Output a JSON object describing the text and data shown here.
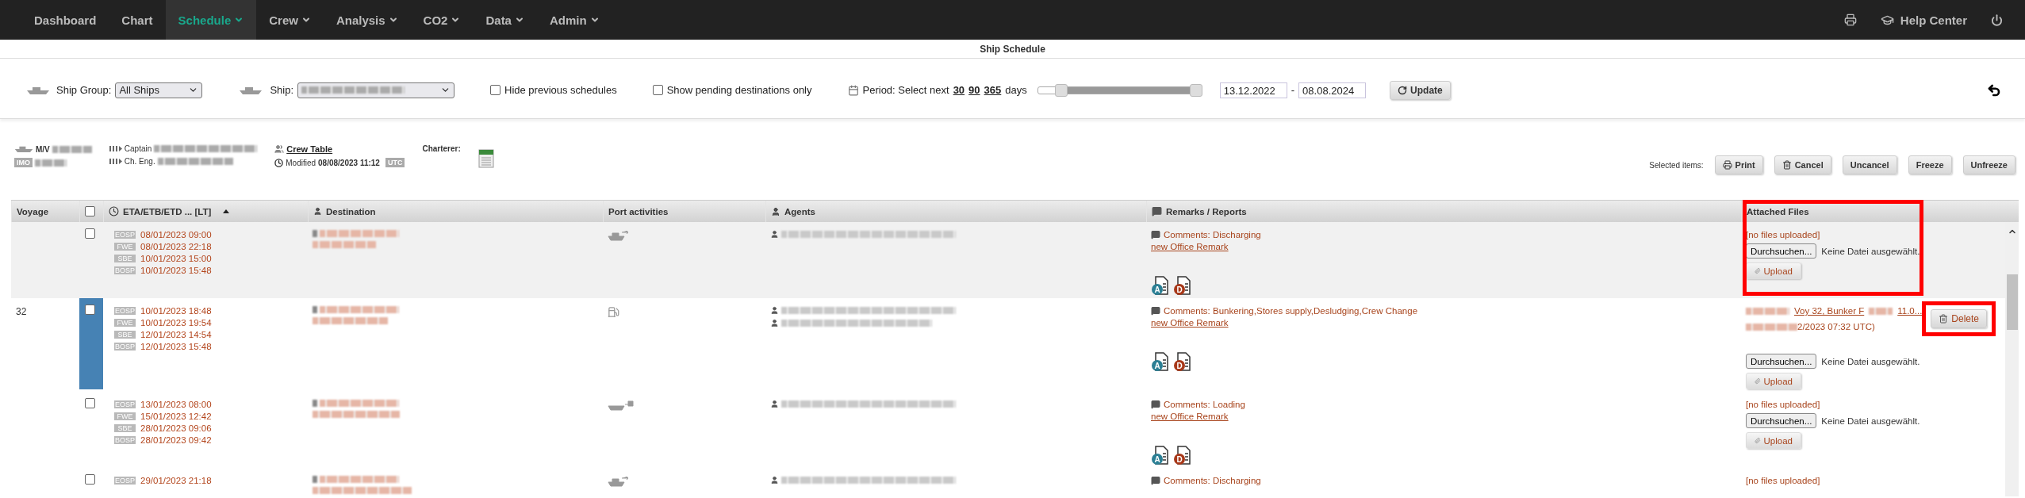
{
  "nav": {
    "items": [
      {
        "label": "Dashboard",
        "selected": false,
        "dropdown": false
      },
      {
        "label": "Chart",
        "selected": false,
        "dropdown": false
      },
      {
        "label": "Schedule",
        "selected": true,
        "dropdown": true
      },
      {
        "label": "Crew",
        "selected": false,
        "dropdown": true
      },
      {
        "label": "Analysis",
        "selected": false,
        "dropdown": true
      },
      {
        "label": "CO2",
        "selected": false,
        "dropdown": true
      },
      {
        "label": "Data",
        "selected": false,
        "dropdown": true
      },
      {
        "label": "Admin",
        "selected": false,
        "dropdown": true
      }
    ],
    "help": "Help Center"
  },
  "page_title": "Ship Schedule",
  "filters": {
    "ship_group_label": "Ship Group:",
    "ship_group_value": "All Ships",
    "ship_label": "Ship:",
    "checkboxes": [
      {
        "label": "Hide previous schedules",
        "checked": false
      },
      {
        "label": "Show pending destinations only",
        "checked": false
      }
    ],
    "period_label": "Period: Select next",
    "period_options": [
      "30",
      "90",
      "365"
    ],
    "period_unit": "days",
    "slider": {
      "thumbs": [
        {
          "level": 0.15
        },
        {
          "level": 1
        }
      ]
    },
    "date_from": "13.12.2022",
    "date_separator": "-",
    "date_to": "08.08.2024",
    "update": "Update"
  },
  "vessel": {
    "prefix": "M/V",
    "imo_badge": "IMO",
    "captain_label": "Captain",
    "chief_label": "Ch. Eng.",
    "crew_table": "Crew Table",
    "modified_label": "Modified",
    "modified": "08/08/2023 11:12",
    "utc_badge": "UTC",
    "charterer_label": "Charterer:"
  },
  "actions": {
    "label": "Selected items:",
    "buttons": [
      {
        "label": "Print"
      },
      {
        "label": "Cancel"
      },
      {
        "label": "Uncancel"
      },
      {
        "label": "Freeze"
      },
      {
        "label": "Unfreeze"
      }
    ]
  },
  "table": {
    "columns": [
      {
        "kind": "text",
        "label": "Voyage"
      },
      {
        "kind": "checkbox",
        "checked": false
      },
      {
        "kind": "text",
        "label": "ETA/ETB/ETD ... [LT]",
        "sorted": true
      },
      {
        "kind": "text",
        "label": "Destination"
      },
      {
        "kind": "text",
        "label": "Port activities"
      },
      {
        "kind": "text",
        "label": "Agents"
      },
      {
        "kind": "text",
        "label": "Remarks / Reports"
      },
      {
        "kind": "text",
        "label": "Attached Files",
        "highlighted": true
      }
    ],
    "rows": [
      {
        "shaded": true,
        "marker": false,
        "checked": false,
        "times": [
          {
            "label": "EOSP",
            "time": "08/01/2023 09:00"
          },
          {
            "label": "FWE",
            "time": "08/01/2023 22:18"
          },
          {
            "label": "SBE",
            "time": "10/01/2023 15:00"
          },
          {
            "label": "BOSP",
            "time": "10/01/2023 15:48"
          }
        ],
        "activity": {
          "kind": "discharging"
        },
        "agents": [
          {
            "kind": "blurred"
          }
        ],
        "comment": "Comments: Discharging",
        "office_remark": "new Office Remark",
        "reports": [
          "A",
          "D"
        ],
        "files": {
          "kind": "empty",
          "status": "[no files uploaded]",
          "browse": "Durchsuchen...",
          "no_file": "Keine Datei ausgewählt.",
          "upload": "Upload"
        }
      },
      {
        "voyage": "32",
        "shaded": false,
        "marker": true,
        "checked": false,
        "times": [
          {
            "label": "EOSP",
            "time": "10/01/2023 18:48"
          },
          {
            "label": "FWE",
            "time": "10/01/2023 19:54"
          },
          {
            "label": "SBE",
            "time": "12/01/2023 14:54"
          },
          {
            "label": "BOSP",
            "time": "12/01/2023 15:48"
          }
        ],
        "activity": {
          "kind": "bunkering"
        },
        "agents": [
          {
            "kind": "blurred"
          },
          {
            "kind": "blurred"
          }
        ],
        "comment": "Comments: Bunkering,Stores supply,Desludging,Crew Change",
        "office_remark": "new Office Remark",
        "reports": [
          "A",
          "D"
        ],
        "files": {
          "kind": "file",
          "link_parts": [
            "Voy 32, Bunker F",
            "11.0..."
          ],
          "uploaded": "2/2023 07:32 UTC)",
          "delete": "Delete",
          "delete_highlighted": true,
          "browse": "Durchsuchen...",
          "no_file": "Keine Datei ausgewählt.",
          "upload": "Upload"
        }
      },
      {
        "shaded": false,
        "marker": false,
        "checked": false,
        "times": [
          {
            "label": "EOSP",
            "time": "13/01/2023 08:00"
          },
          {
            "label": "FWE",
            "time": "15/01/2023 12:42"
          },
          {
            "label": "SBE",
            "time": "28/01/2023 09:06"
          },
          {
            "label": "BOSP",
            "time": "28/01/2023 09:42"
          }
        ],
        "activity": {
          "kind": "loading"
        },
        "agents": [
          {
            "kind": "blurred"
          }
        ],
        "comment": "Comments: Loading",
        "office_remark": "new Office Remark",
        "reports": [
          "A",
          "D"
        ],
        "files": {
          "kind": "empty",
          "status": "[no files uploaded]",
          "browse": "Durchsuchen...",
          "no_file": "Keine Datei ausgewählt.",
          "upload": "Upload"
        }
      },
      {
        "shaded": false,
        "marker": false,
        "checked": false,
        "times": [
          {
            "label": "EOSP",
            "time": "29/01/2023 21:18"
          }
        ],
        "activity": {
          "kind": "discharging"
        },
        "agents": [
          {
            "kind": "blurred"
          }
        ],
        "comment": "Comments: Discharging",
        "files": {
          "kind": "status",
          "status": "[no files uploaded]"
        }
      }
    ]
  }
}
